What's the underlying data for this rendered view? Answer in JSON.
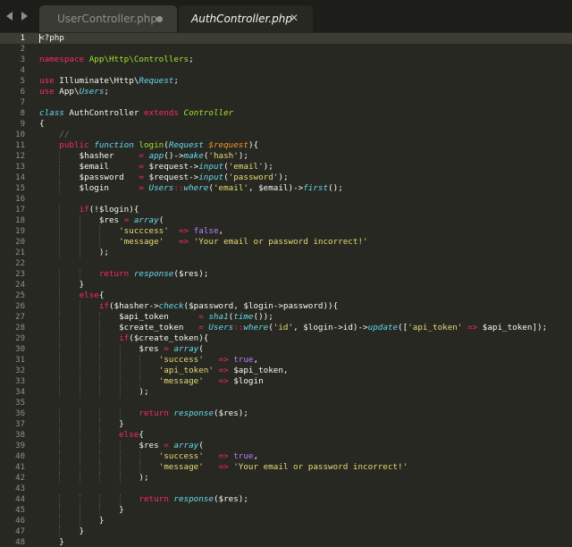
{
  "tabs": [
    {
      "label": "UserController.php",
      "active": false,
      "modified": true
    },
    {
      "label": "AuthController.php",
      "active": true,
      "close_icon": "close-icon"
    }
  ],
  "colors": {
    "background": "#272822",
    "tabbar": "#1d1e19",
    "keyword": "#f92672",
    "storage": "#66d9ef",
    "function": "#a6e22e",
    "parameter": "#fd971f",
    "string": "#e6db74",
    "constant": "#ae81ff",
    "comment": "#75715e"
  },
  "active_line": 1,
  "code_lines": [
    [
      [
        "<?php",
        "plain"
      ]
    ],
    [],
    [
      [
        "namespace ",
        "kw"
      ],
      [
        "App\\Http\\Controllers",
        "fn"
      ],
      [
        ";",
        "plain"
      ]
    ],
    [],
    [
      [
        "use ",
        "kw"
      ],
      [
        "Illuminate\\Http\\",
        "plain"
      ],
      [
        "Request",
        "st"
      ],
      [
        ";",
        "plain"
      ]
    ],
    [
      [
        "use ",
        "kw"
      ],
      [
        "App\\",
        "plain"
      ],
      [
        "Users",
        "st"
      ],
      [
        ";",
        "plain"
      ]
    ],
    [],
    [
      [
        "class ",
        "st"
      ],
      [
        "AuthController ",
        "plain"
      ],
      [
        "extends ",
        "kw"
      ],
      [
        "Controller",
        "cls"
      ]
    ],
    [
      [
        "{",
        "plain"
      ]
    ],
    [
      [
        "    //",
        "cmt"
      ]
    ],
    [
      [
        "    public ",
        "kw"
      ],
      [
        "function ",
        "st"
      ],
      [
        "login",
        "fn"
      ],
      [
        "(",
        "plain"
      ],
      [
        "Request ",
        "st"
      ],
      [
        "$request",
        "prm"
      ],
      [
        "){",
        "plain"
      ]
    ],
    [
      [
        "        $hasher     ",
        "plain"
      ],
      [
        "= ",
        "kw"
      ],
      [
        "app",
        "st"
      ],
      [
        "()->",
        "plain"
      ],
      [
        "make",
        "st"
      ],
      [
        "(",
        "plain"
      ],
      [
        "'hash'",
        "str"
      ],
      [
        ");",
        "plain"
      ]
    ],
    [
      [
        "        $email      ",
        "plain"
      ],
      [
        "= ",
        "kw"
      ],
      [
        "$request->",
        "plain"
      ],
      [
        "input",
        "st"
      ],
      [
        "(",
        "plain"
      ],
      [
        "'email'",
        "str"
      ],
      [
        ");",
        "plain"
      ]
    ],
    [
      [
        "        $password   ",
        "plain"
      ],
      [
        "= ",
        "kw"
      ],
      [
        "$request->",
        "plain"
      ],
      [
        "input",
        "st"
      ],
      [
        "(",
        "plain"
      ],
      [
        "'password'",
        "str"
      ],
      [
        ");",
        "plain"
      ]
    ],
    [
      [
        "        $login      ",
        "plain"
      ],
      [
        "= ",
        "kw"
      ],
      [
        "Users",
        "st"
      ],
      [
        "::",
        "kw"
      ],
      [
        "where",
        "st"
      ],
      [
        "(",
        "plain"
      ],
      [
        "'email'",
        "str"
      ],
      [
        ", $email)->",
        "plain"
      ],
      [
        "first",
        "st"
      ],
      [
        "();",
        "plain"
      ]
    ],
    [],
    [
      [
        "        ",
        "plain"
      ],
      [
        "if",
        "kw"
      ],
      [
        "(!$login){",
        "plain"
      ]
    ],
    [
      [
        "            $res ",
        "plain"
      ],
      [
        "= ",
        "kw"
      ],
      [
        "array",
        "st"
      ],
      [
        "(",
        "plain"
      ]
    ],
    [
      [
        "                ",
        "plain"
      ],
      [
        "'succcess'",
        "str"
      ],
      [
        "  ",
        "plain"
      ],
      [
        "=> ",
        "kw"
      ],
      [
        "false",
        "cst"
      ],
      [
        ",",
        "plain"
      ]
    ],
    [
      [
        "                ",
        "plain"
      ],
      [
        "'message'",
        "str"
      ],
      [
        "   ",
        "plain"
      ],
      [
        "=> ",
        "kw"
      ],
      [
        "'Your email or password incorrect!'",
        "str"
      ]
    ],
    [
      [
        "            );",
        "plain"
      ]
    ],
    [],
    [
      [
        "            ",
        "plain"
      ],
      [
        "return ",
        "kw"
      ],
      [
        "response",
        "st"
      ],
      [
        "($res);",
        "plain"
      ]
    ],
    [
      [
        "        }",
        "plain"
      ]
    ],
    [
      [
        "        ",
        "plain"
      ],
      [
        "else",
        "kw"
      ],
      [
        "{",
        "plain"
      ]
    ],
    [
      [
        "            ",
        "plain"
      ],
      [
        "if",
        "kw"
      ],
      [
        "($hasher->",
        "plain"
      ],
      [
        "check",
        "st"
      ],
      [
        "($password, $login->password)){",
        "plain"
      ]
    ],
    [
      [
        "                $api_token      ",
        "plain"
      ],
      [
        "= ",
        "kw"
      ],
      [
        "sha1",
        "st"
      ],
      [
        "(",
        "plain"
      ],
      [
        "time",
        "st"
      ],
      [
        "());",
        "plain"
      ]
    ],
    [
      [
        "                $create_token   ",
        "plain"
      ],
      [
        "= ",
        "kw"
      ],
      [
        "Users",
        "st"
      ],
      [
        "::",
        "kw"
      ],
      [
        "where",
        "st"
      ],
      [
        "(",
        "plain"
      ],
      [
        "'id'",
        "str"
      ],
      [
        ", $login->id)->",
        "plain"
      ],
      [
        "update",
        "st"
      ],
      [
        "([",
        "plain"
      ],
      [
        "'api_token'",
        "str"
      ],
      [
        " ",
        "plain"
      ],
      [
        "=> ",
        "kw"
      ],
      [
        "$api_token]);",
        "plain"
      ]
    ],
    [
      [
        "                ",
        "plain"
      ],
      [
        "if",
        "kw"
      ],
      [
        "($create_token){",
        "plain"
      ]
    ],
    [
      [
        "                    $res ",
        "plain"
      ],
      [
        "= ",
        "kw"
      ],
      [
        "array",
        "st"
      ],
      [
        "(",
        "plain"
      ]
    ],
    [
      [
        "                        ",
        "plain"
      ],
      [
        "'success'",
        "str"
      ],
      [
        "   ",
        "plain"
      ],
      [
        "=> ",
        "kw"
      ],
      [
        "true",
        "cst"
      ],
      [
        ",",
        "plain"
      ]
    ],
    [
      [
        "                        ",
        "plain"
      ],
      [
        "'api_token'",
        "str"
      ],
      [
        " ",
        "plain"
      ],
      [
        "=> ",
        "kw"
      ],
      [
        "$api_token,",
        "plain"
      ]
    ],
    [
      [
        "                        ",
        "plain"
      ],
      [
        "'message'",
        "str"
      ],
      [
        "   ",
        "plain"
      ],
      [
        "=> ",
        "kw"
      ],
      [
        "$login",
        "plain"
      ]
    ],
    [
      [
        "                    );",
        "plain"
      ]
    ],
    [],
    [
      [
        "                    ",
        "plain"
      ],
      [
        "return ",
        "kw"
      ],
      [
        "response",
        "st"
      ],
      [
        "($res);",
        "plain"
      ]
    ],
    [
      [
        "                }",
        "plain"
      ]
    ],
    [
      [
        "                ",
        "plain"
      ],
      [
        "else",
        "kw"
      ],
      [
        "{",
        "plain"
      ]
    ],
    [
      [
        "                    $res ",
        "plain"
      ],
      [
        "= ",
        "kw"
      ],
      [
        "array",
        "st"
      ],
      [
        "(",
        "plain"
      ]
    ],
    [
      [
        "                        ",
        "plain"
      ],
      [
        "'success'",
        "str"
      ],
      [
        "   ",
        "plain"
      ],
      [
        "=> ",
        "kw"
      ],
      [
        "true",
        "cst"
      ],
      [
        ",",
        "plain"
      ]
    ],
    [
      [
        "                        ",
        "plain"
      ],
      [
        "'message'",
        "str"
      ],
      [
        "   ",
        "plain"
      ],
      [
        "=> ",
        "kw"
      ],
      [
        "'Your email or password incorrect!'",
        "str"
      ]
    ],
    [
      [
        "                    );",
        "plain"
      ]
    ],
    [],
    [
      [
        "                    ",
        "plain"
      ],
      [
        "return ",
        "kw"
      ],
      [
        "response",
        "st"
      ],
      [
        "($res);",
        "plain"
      ]
    ],
    [
      [
        "                }",
        "plain"
      ]
    ],
    [
      [
        "            }",
        "plain"
      ]
    ],
    [
      [
        "        }",
        "plain"
      ]
    ],
    [
      [
        "    }",
        "plain"
      ]
    ]
  ]
}
